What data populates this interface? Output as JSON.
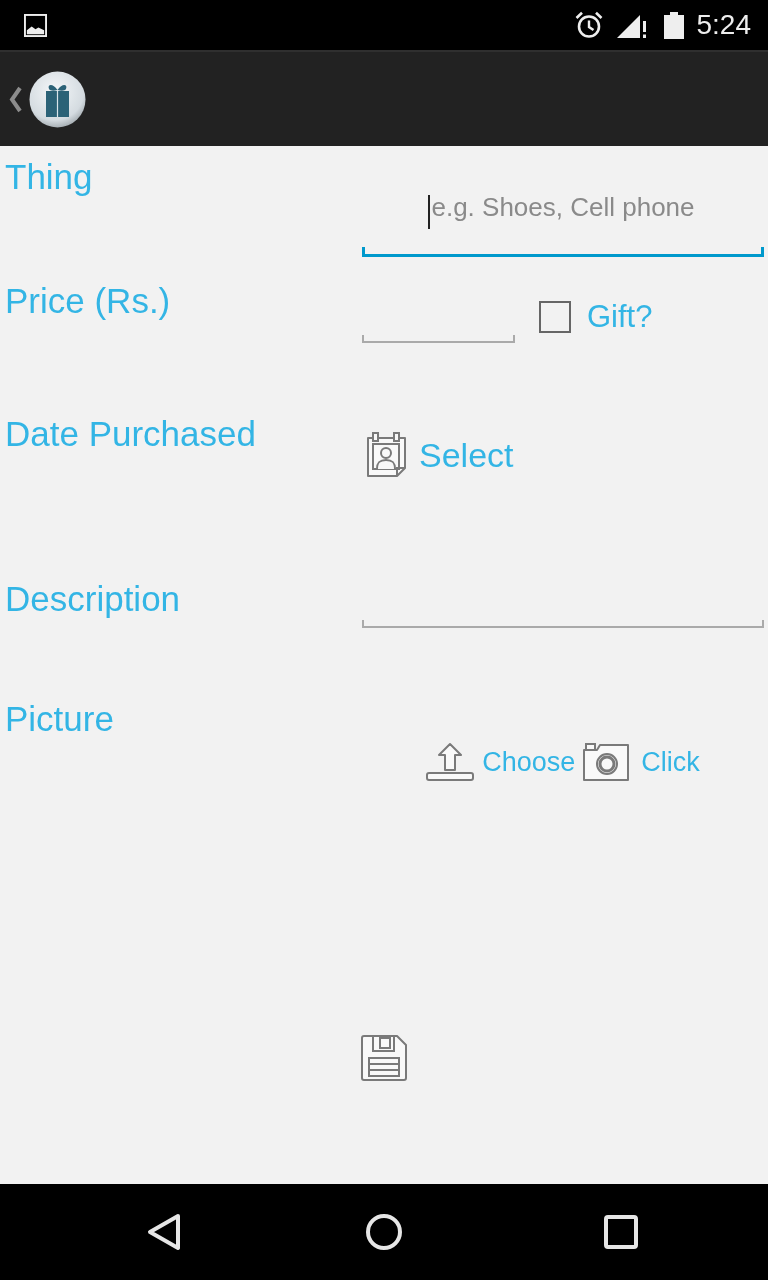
{
  "status_bar": {
    "time": "5:24"
  },
  "form": [
    {
      "kind": "text",
      "label": "Thing",
      "placeholder": "e.g. Shoes, Cell phone",
      "focused": true
    },
    {
      "kind": "price",
      "label": "Price (Rs.)",
      "focused": false,
      "checkbox": {
        "label": "Gift?",
        "checked": false
      }
    },
    {
      "kind": "date",
      "label": "Date Purchased",
      "button": "Select"
    },
    {
      "kind": "text",
      "label": "Description",
      "focused": false
    },
    {
      "kind": "picture",
      "label": "Picture",
      "buttons": [
        {
          "kind": "upload",
          "label": "Choose"
        },
        {
          "kind": "camera",
          "label": "Click"
        }
      ]
    }
  ]
}
